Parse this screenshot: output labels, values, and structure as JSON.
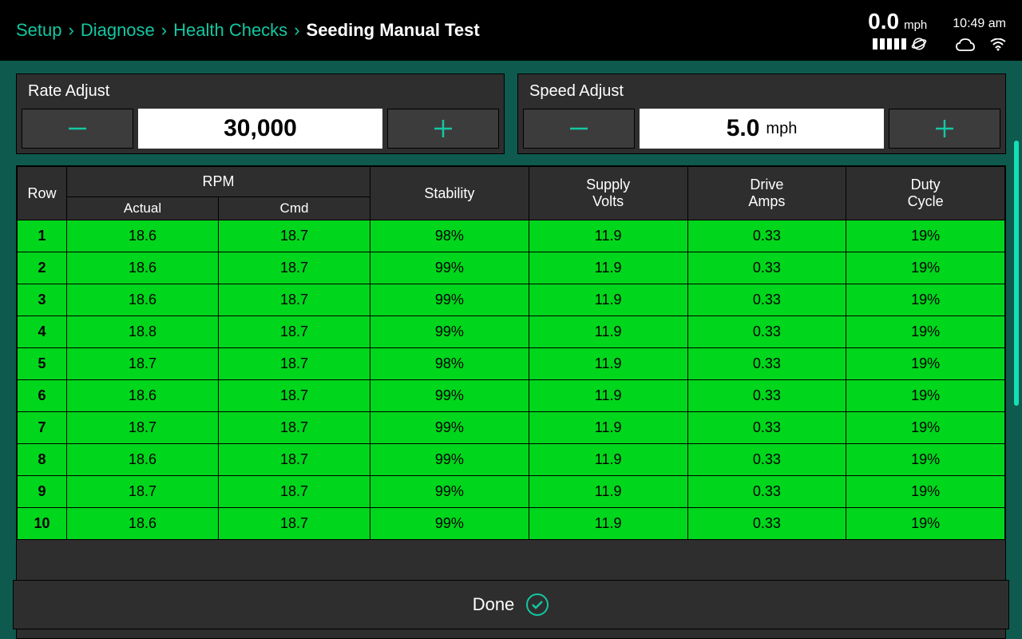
{
  "breadcrumb": {
    "items": [
      "Setup",
      "Diagnose",
      "Health Checks"
    ],
    "current": "Seeding Manual Test"
  },
  "status": {
    "speed_value": "0.0",
    "speed_unit": "mph",
    "time": "10:49 am"
  },
  "adjust": {
    "rate": {
      "title": "Rate Adjust",
      "value": "30,000",
      "unit": ""
    },
    "speed": {
      "title": "Speed Adjust",
      "value": "5.0",
      "unit": "mph"
    }
  },
  "table": {
    "headers": {
      "row": "Row",
      "rpm": "RPM",
      "rpm_actual": "Actual",
      "rpm_cmd": "Cmd",
      "stability": "Stability",
      "supply_volts": "Supply\nVolts",
      "drive_amps": "Drive\nAmps",
      "duty_cycle": "Duty\nCycle"
    },
    "rows": [
      {
        "row": "1",
        "actual": "18.6",
        "cmd": "18.7",
        "stability": "98%",
        "volts": "11.9",
        "amps": "0.33",
        "duty": "19%"
      },
      {
        "row": "2",
        "actual": "18.6",
        "cmd": "18.7",
        "stability": "99%",
        "volts": "11.9",
        "amps": "0.33",
        "duty": "19%"
      },
      {
        "row": "3",
        "actual": "18.6",
        "cmd": "18.7",
        "stability": "99%",
        "volts": "11.9",
        "amps": "0.33",
        "duty": "19%"
      },
      {
        "row": "4",
        "actual": "18.8",
        "cmd": "18.7",
        "stability": "99%",
        "volts": "11.9",
        "amps": "0.33",
        "duty": "19%"
      },
      {
        "row": "5",
        "actual": "18.7",
        "cmd": "18.7",
        "stability": "98%",
        "volts": "11.9",
        "amps": "0.33",
        "duty": "19%"
      },
      {
        "row": "6",
        "actual": "18.6",
        "cmd": "18.7",
        "stability": "99%",
        "volts": "11.9",
        "amps": "0.33",
        "duty": "19%"
      },
      {
        "row": "7",
        "actual": "18.7",
        "cmd": "18.7",
        "stability": "99%",
        "volts": "11.9",
        "amps": "0.33",
        "duty": "19%"
      },
      {
        "row": "8",
        "actual": "18.6",
        "cmd": "18.7",
        "stability": "99%",
        "volts": "11.9",
        "amps": "0.33",
        "duty": "19%"
      },
      {
        "row": "9",
        "actual": "18.7",
        "cmd": "18.7",
        "stability": "99%",
        "volts": "11.9",
        "amps": "0.33",
        "duty": "19%"
      },
      {
        "row": "10",
        "actual": "18.6",
        "cmd": "18.7",
        "stability": "99%",
        "volts": "11.9",
        "amps": "0.33",
        "duty": "19%"
      }
    ]
  },
  "done_label": "Done"
}
